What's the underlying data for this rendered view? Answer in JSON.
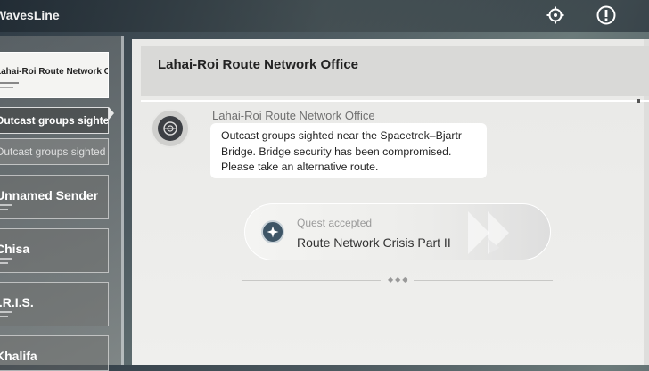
{
  "app": {
    "title": "WavesLine"
  },
  "toolbar": {
    "target_icon": "crosshair-icon",
    "alert_icon": "exclamation-icon"
  },
  "sidebar": {
    "contacts": [
      {
        "name": "Lahai-Roi Route Network Office",
        "state": "selected"
      },
      {
        "name": "Outcast groups sighted ...",
        "state": "active-thread"
      },
      {
        "name": "Outcast groups sighted ...",
        "state": "thread"
      },
      {
        "name": "Unnamed Sender",
        "state": "normal"
      },
      {
        "name": "Chisa",
        "state": "normal"
      },
      {
        "name": "I.R.I.S.",
        "state": "normal"
      },
      {
        "name": "Khalifa",
        "state": "normal"
      }
    ]
  },
  "chat": {
    "title": "Lahai-Roi Route Network Office",
    "messages": [
      {
        "sender": "Lahai-Roi Route Network Office",
        "lines": [
          "Outcast groups sighted near the Spacetrek–Bjartr",
          "Bridge. Bridge security has been compromised.",
          "Please take an alternative route."
        ]
      }
    ],
    "quest": {
      "label": "Quest accepted",
      "name": "Route Network Crisis Part II",
      "icon": "compass-icon"
    }
  }
}
